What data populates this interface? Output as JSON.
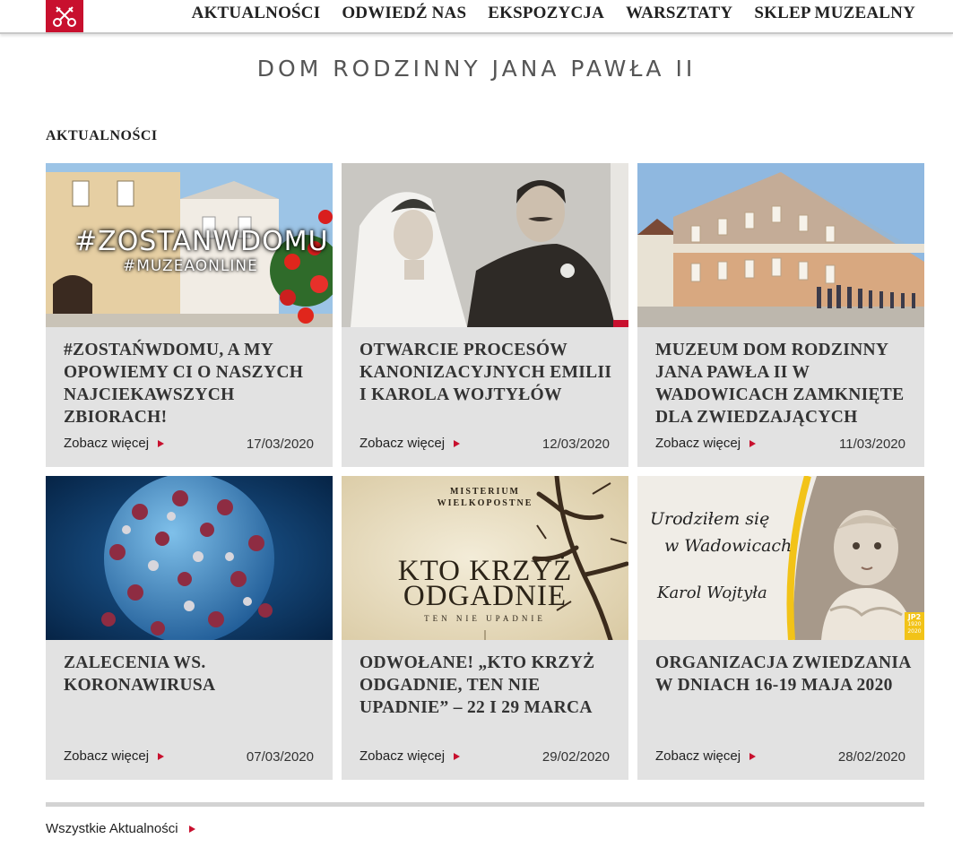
{
  "nav": {
    "logo_icon": "crossed-keys-icon",
    "items": [
      "AKTUALNOŚCI",
      "ODWIEDŹ NAS",
      "EKSPOZYCJA",
      "WARSZTATY",
      "SKLEP MUZEALNY"
    ]
  },
  "site_title": "DOM RODZINNY JANA PAWŁA II",
  "section_heading": "AKTUALNOŚCI",
  "more_label": "Zobacz więcej",
  "cards": [
    {
      "title": "#ZOSTAŃWDOMU, A MY OPOWIEMY CI O NASZYCH NAJCIEKAWSZYCH ZBIORACH!",
      "date": "17/03/2020",
      "image_text": [
        "#ZOSTANWDOMU",
        "#MUZEAONLINE"
      ]
    },
    {
      "title": "OTWARCIE PROCESÓW KANONIZACYJNYCH EMILII I KAROLA WOJTYŁÓW",
      "date": "12/03/2020"
    },
    {
      "title": "MUZEUM DOM RODZINNY JANA PAWŁA II W WADOWICACH ZAMKNIĘTE DLA ZWIEDZAJĄCYCH",
      "date": "11/03/2020"
    },
    {
      "title": "ZALECENIA WS. KORONAWIRUSA",
      "date": "07/03/2020"
    },
    {
      "title": "ODWOŁANE! „KTO KRZYŻ ODGADNIE, TEN NIE UPADNIE” – 22 I 29 MARCA",
      "date": "29/02/2020",
      "image_text": [
        "MISTERIUM",
        "WIELKOPOSTNE",
        "KTO KRZYŻ",
        "ODGADNIE",
        "TEN NIE UPADNIE"
      ]
    },
    {
      "title": "ORGANIZACJA ZWIEDZANIA W DNIACH 16-19 MAJA 2020",
      "date": "28/02/2020",
      "image_text": [
        "Urodziłem się",
        "w Wadowicach",
        "Karol Wojtyła",
        "JP2",
        "1920",
        "2020"
      ]
    }
  ],
  "all_news_label": "Wszystkie Aktualności",
  "colors": {
    "accent": "#c8102e",
    "card_bg": "#e2e2e2",
    "divider": "#d3d3d3",
    "text": "#333333"
  }
}
